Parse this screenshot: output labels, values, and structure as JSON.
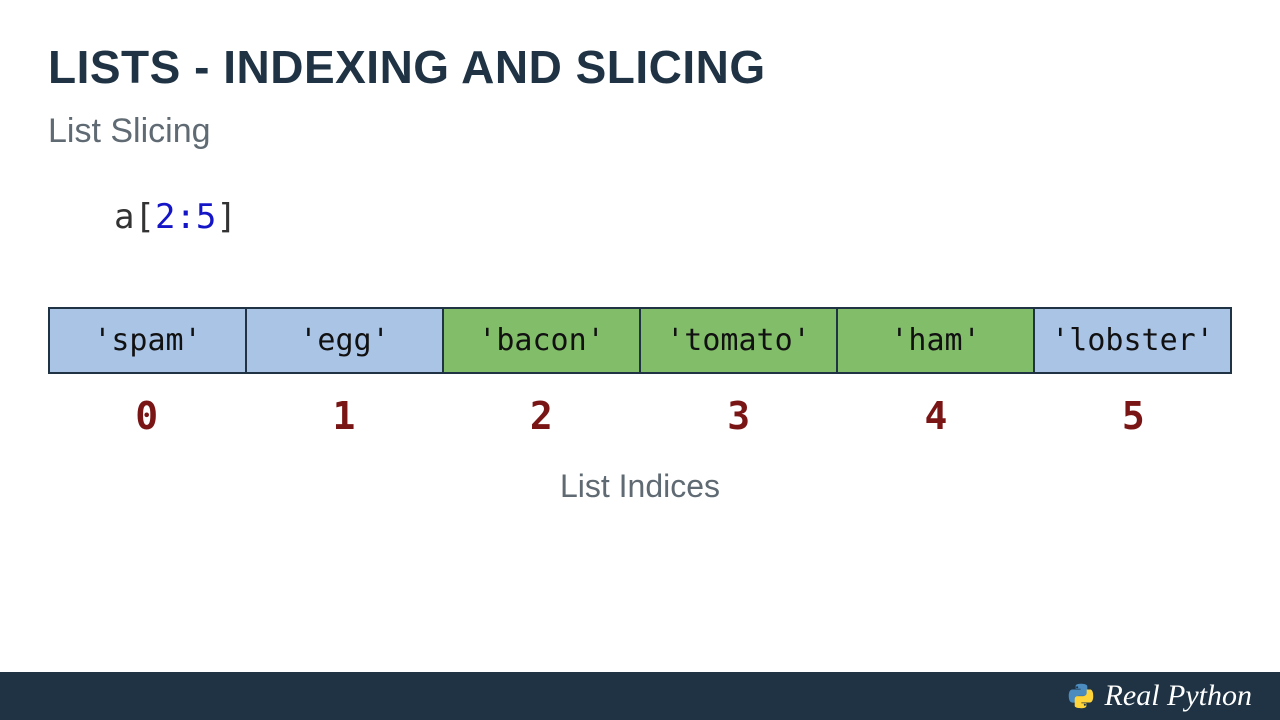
{
  "title": "LISTS - INDEXING AND SLICING",
  "subtitle": "List Slicing",
  "code": {
    "var": "a",
    "open": "[",
    "arg": "2:5",
    "close": "]"
  },
  "cells": [
    {
      "label": "'spam'",
      "highlight": false
    },
    {
      "label": "'egg'",
      "highlight": false
    },
    {
      "label": "'bacon'",
      "highlight": true
    },
    {
      "label": "'tomato'",
      "highlight": true
    },
    {
      "label": "'ham'",
      "highlight": true
    },
    {
      "label": "'lobster'",
      "highlight": false
    }
  ],
  "indices": [
    "0",
    "1",
    "2",
    "3",
    "4",
    "5"
  ],
  "caption": "List Indices",
  "brand": "Real Python",
  "colors": {
    "blue": "#aac4e6",
    "green": "#82bd69",
    "dark": "#1f3344",
    "indexRed": "#7a1515"
  }
}
